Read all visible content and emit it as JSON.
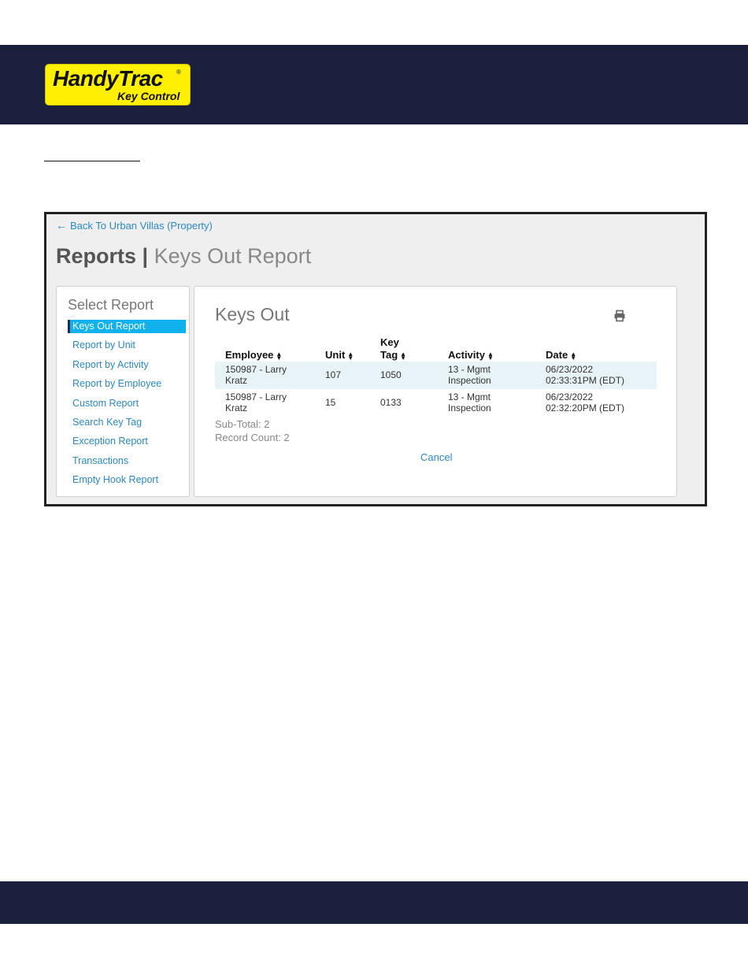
{
  "logo": {
    "main": "HandyTrac",
    "reg": "®",
    "sub": "Key Control"
  },
  "colors": {
    "navy": "#1a1f3d",
    "yellow": "#ffef00",
    "link": "#2a89c8",
    "active": "#10b2ee"
  },
  "back_link": {
    "icon": "arrow-left-icon",
    "label": "Back To Urban Villas (Property)"
  },
  "title": {
    "main": "Reports",
    "sep": "|",
    "sub": "Keys Out Report"
  },
  "sidebar": {
    "heading": "Select Report",
    "items": [
      {
        "label": "Keys Out Report",
        "active": true
      },
      {
        "label": "Report by Unit"
      },
      {
        "label": "Report by Activity"
      },
      {
        "label": "Report by Employee"
      },
      {
        "label": "Custom Report"
      },
      {
        "label": "Search Key Tag"
      },
      {
        "label": "Exception Report"
      },
      {
        "label": "Transactions"
      },
      {
        "label": "Empty Hook Report"
      }
    ]
  },
  "report": {
    "heading": "Keys Out",
    "print_icon": "print-icon",
    "columns": [
      "Employee",
      "Unit",
      "Key Tag",
      "Activity",
      "Date"
    ],
    "rows": [
      {
        "employee_1": "150987 - Larry",
        "employee_2": "Kratz",
        "unit": "107",
        "key_tag": "1050",
        "activity_1": "13 - Mgmt",
        "activity_2": "Inspection",
        "date_1": "06/23/2022",
        "date_2": "02:33:31PM (EDT)"
      },
      {
        "employee_1": "150987 - Larry",
        "employee_2": "Kratz",
        "unit": "15",
        "key_tag": "0133",
        "activity_1": "13 - Mgmt",
        "activity_2": "Inspection",
        "date_1": "06/23/2022",
        "date_2": "02:32:20PM (EDT)"
      }
    ],
    "subtotal": "Sub-Total: 2",
    "record_count": "Record Count: 2",
    "cancel": "Cancel"
  }
}
